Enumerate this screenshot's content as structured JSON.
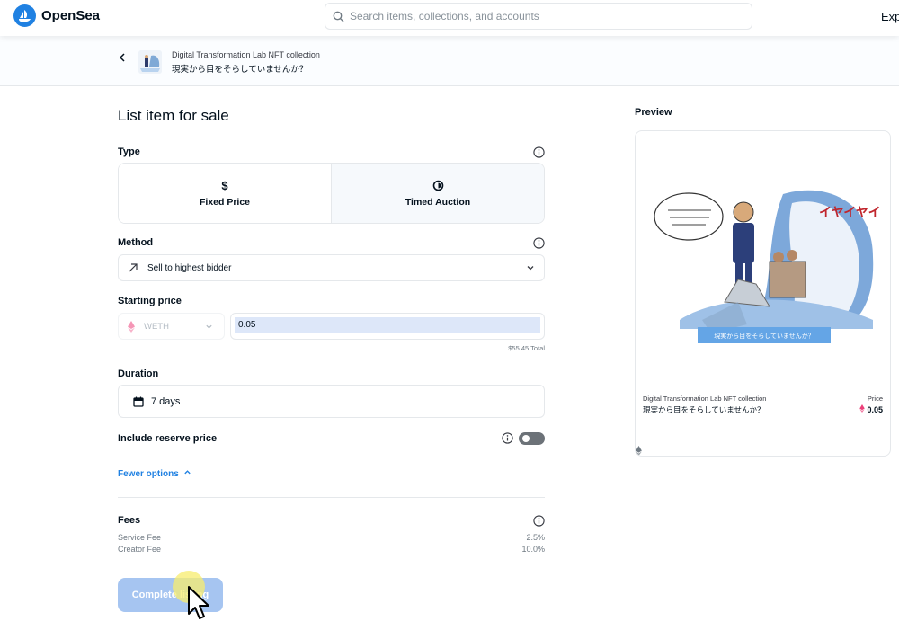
{
  "header": {
    "brand": "OpenSea",
    "search_placeholder": "Search items, collections, and accounts",
    "nav_explore": "Expl"
  },
  "item": {
    "collection": "Digital Transformation Lab NFT collection",
    "name": "現実から目をそらしていませんか？"
  },
  "form": {
    "title": "List item for sale",
    "type_label": "Type",
    "type_options": [
      {
        "label": "Fixed Price",
        "icon": "dollar-icon"
      },
      {
        "label": "Timed Auction",
        "icon": "clock-icon"
      }
    ],
    "selected_type": "Timed Auction",
    "method_label": "Method",
    "method_value": "Sell to highest bidder",
    "starting_price_label": "Starting price",
    "currency": "WETH",
    "price_value": "0.05",
    "total": "$55.45 Total",
    "duration_label": "Duration",
    "duration_value": "7 days",
    "reserve_label": "Include reserve price",
    "reserve_enabled": false,
    "fewer_options": "Fewer options",
    "fees_label": "Fees",
    "fees": [
      {
        "label": "Service Fee",
        "value": "2.5%"
      },
      {
        "label": "Creator Fee",
        "value": "10.0%"
      }
    ],
    "complete_button": "Complete listing"
  },
  "preview": {
    "label": "Preview",
    "price_label": "Price",
    "price_value": "0.05",
    "art_banner": "現実から目をそらしていませんか？",
    "art_text": "イヤイヤイヤ"
  },
  "colors": {
    "accent": "#2081e2",
    "button_disabled": "#a6c5f1",
    "weth": "#ec407a"
  }
}
